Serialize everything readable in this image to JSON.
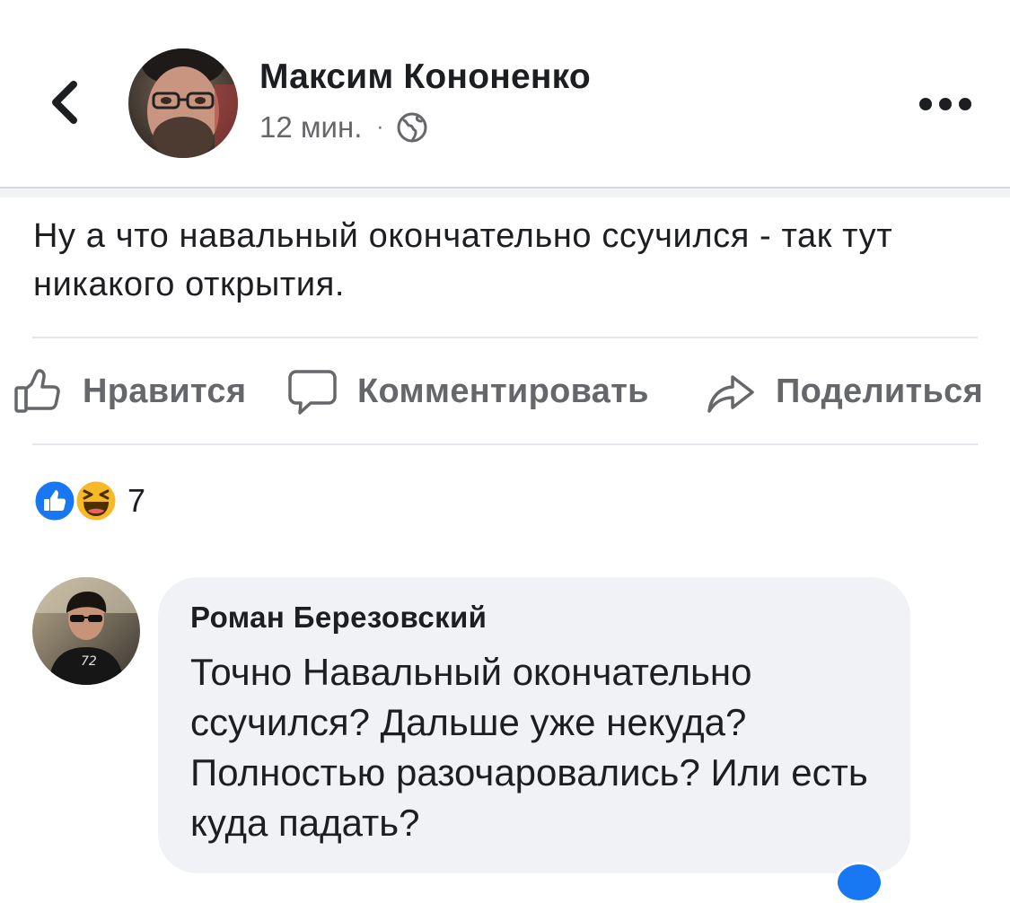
{
  "post": {
    "author_name": "Максим Кононенко",
    "time": "12 мин.",
    "separator": "·",
    "visibility_icon": "globe-icon",
    "text": "Ну а что навальный окончательно ссучился - так тут никакого открытия."
  },
  "header": {
    "back_icon": "chevron-left-icon",
    "more_icon": "more-horizontal-icon"
  },
  "actions": {
    "like_label": "Нравится",
    "comment_label": "Комментировать",
    "share_label": "Поделиться"
  },
  "reactions": {
    "types": [
      "like",
      "haha"
    ],
    "count": "7"
  },
  "comment": {
    "author_name": "Роман Березовский",
    "text": "Точно Навальный окончательно ссучился? Дальше уже некуда? Полностью разочаровались? Или есть куда падать?"
  },
  "colors": {
    "text_primary": "#1c1e21",
    "text_secondary": "#65676b",
    "like_blue": "#1877f2",
    "haha_yellow": "#f7b928",
    "bubble_bg": "#f0f2f5",
    "divider": "#e4e6eb"
  }
}
